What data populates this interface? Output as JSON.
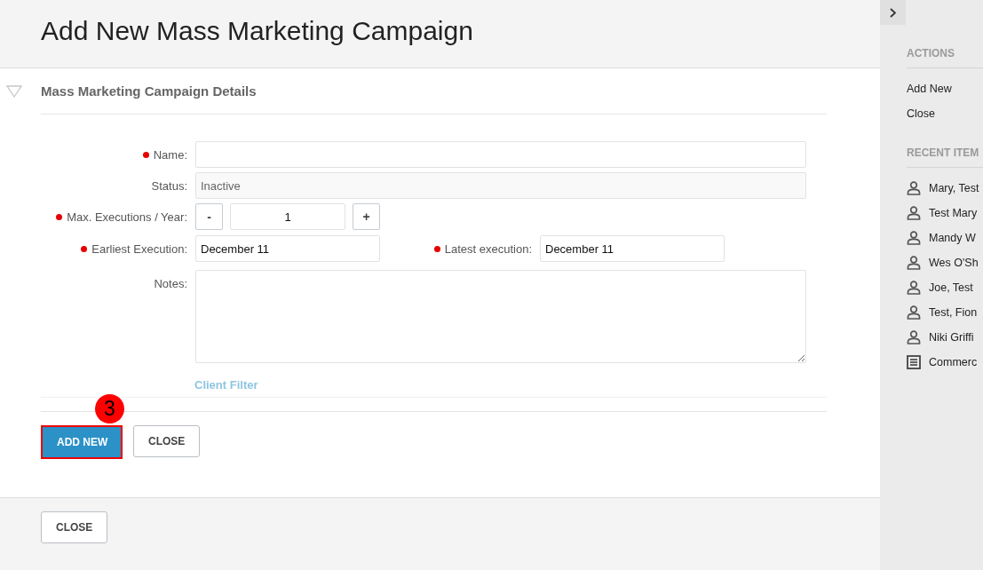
{
  "page_title": "Add New Mass Marketing Campaign",
  "section": {
    "title": "Mass Marketing Campaign Details",
    "expanded": true
  },
  "form": {
    "fields": [
      {
        "kind": "text",
        "label": "Name:",
        "required": true
      },
      {
        "kind": "readonly",
        "label": "Status:",
        "required": false,
        "value": "Inactive"
      },
      {
        "kind": "stepper",
        "label": "Max. Executions / Year:",
        "required": true,
        "value": "1",
        "decrement": "-",
        "increment": "+"
      },
      {
        "kind": "date_range",
        "label": "Earliest Execution:",
        "required": true,
        "value": "December 11",
        "end_label": "Latest execution:",
        "end_required": true,
        "end_value": "December 11"
      },
      {
        "kind": "textarea",
        "label": "Notes:",
        "required": false
      }
    ],
    "link": "Client Filter",
    "buttons": [
      {
        "kind": "primary",
        "label": "ADD NEW",
        "highlighted": true,
        "step_marker": "3"
      },
      {
        "kind": "secondary",
        "label": "CLOSE",
        "highlighted": false
      }
    ]
  },
  "footer": {
    "buttons": [
      {
        "kind": "secondary",
        "label": "CLOSE"
      }
    ]
  },
  "sidebar": {
    "sections": [
      {
        "title": "ACTIONS",
        "items": [
          {
            "label": "Add New"
          },
          {
            "label": "Close"
          }
        ]
      },
      {
        "title": "RECENT ITEM",
        "items": [
          {
            "kind": "contact",
            "label": "Mary, Test"
          },
          {
            "kind": "contact",
            "label": "Test Mary"
          },
          {
            "kind": "contact",
            "label": "Mandy W"
          },
          {
            "kind": "contact",
            "label": "Wes O'Sh"
          },
          {
            "kind": "contact",
            "label": "Joe, Test"
          },
          {
            "kind": "contact",
            "label": "Test, Fion"
          },
          {
            "kind": "contact",
            "label": "Niki Griffi"
          },
          {
            "kind": "document",
            "label": "Commerc"
          }
        ]
      }
    ]
  }
}
